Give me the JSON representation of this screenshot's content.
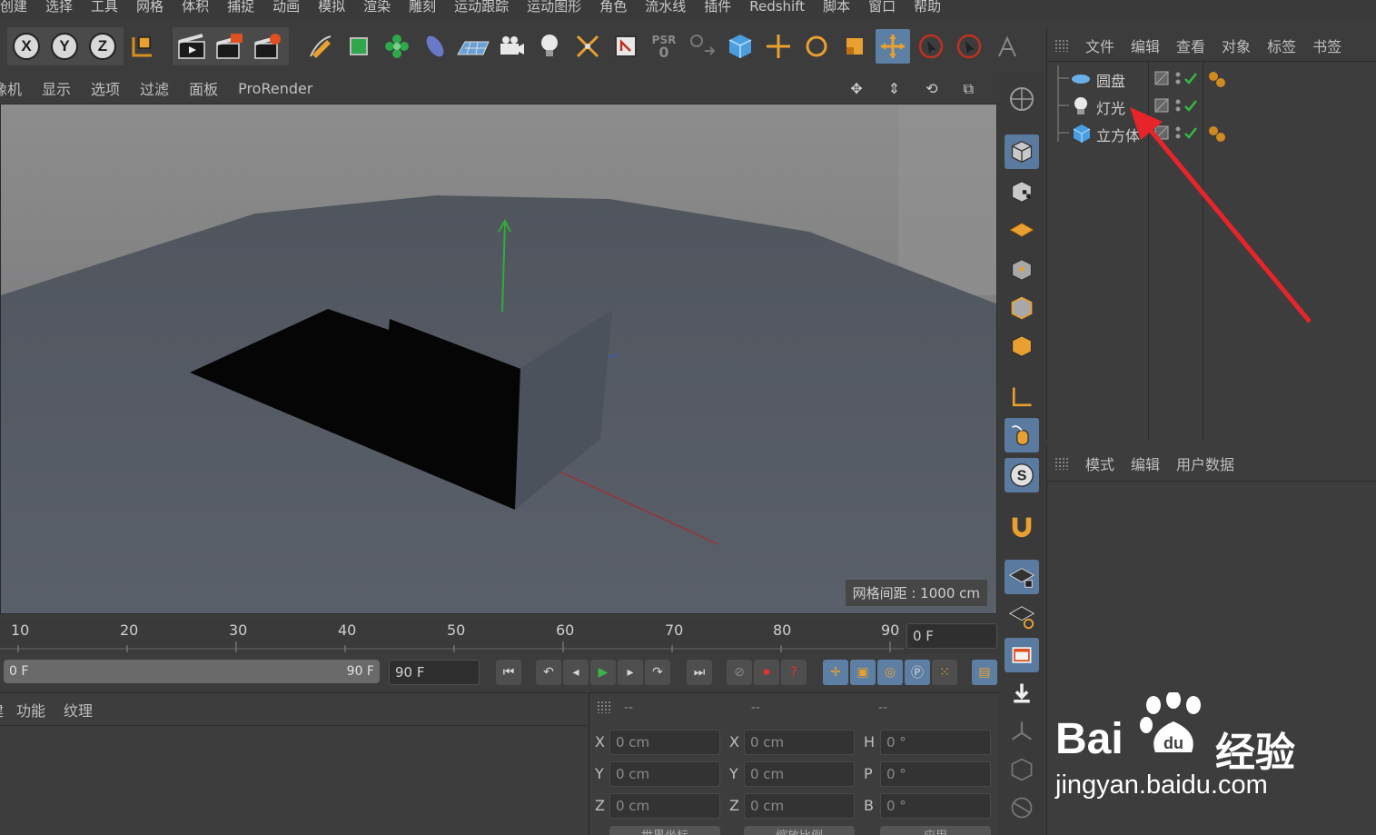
{
  "menubar": {
    "items": [
      "创建",
      "选择",
      "工具",
      "网格",
      "体积",
      "捕捉",
      "动画",
      "模拟",
      "渲染",
      "雕刻",
      "运动跟踪",
      "运动图形",
      "角色",
      "流水线",
      "插件",
      "Redshift",
      "脚本",
      "窗口",
      "帮助"
    ]
  },
  "toolbar": {
    "axis_x": "X",
    "axis_y": "Y",
    "axis_z": "Z",
    "psr_label": "PSR",
    "psr_value": "0"
  },
  "viewport_menu": {
    "items": [
      "摄像机",
      "显示",
      "选项",
      "过滤",
      "面板",
      "ProRender"
    ]
  },
  "viewport": {
    "grid_spacing": "网格间距 : 1000 cm"
  },
  "object_manager": {
    "menu": [
      "文件",
      "编辑",
      "查看",
      "对象",
      "标签",
      "书签"
    ],
    "objects": [
      {
        "name": "圆盘",
        "icon": "disc-icon"
      },
      {
        "name": "灯光",
        "icon": "light-bulb-icon"
      },
      {
        "name": "立方体",
        "icon": "cube-icon"
      }
    ]
  },
  "attribute_manager": {
    "menu": [
      "模式",
      "编辑",
      "用户数据"
    ]
  },
  "timeline": {
    "ticks": [
      "10",
      "20",
      "30",
      "40",
      "50",
      "60",
      "70",
      "80",
      "90"
    ],
    "current_frame": "0 F"
  },
  "playback": {
    "range_start": "0 F",
    "range_end": "90 F",
    "end_frame": "90 F"
  },
  "material_manager": {
    "menu": [
      "创建",
      "功能",
      "纹理"
    ]
  },
  "coordinates": {
    "headers": [
      "--",
      "--",
      "--"
    ],
    "rows": [
      {
        "pos_label": "X",
        "pos": "0 cm",
        "size_label": "X",
        "size": "0 cm",
        "rot_label": "H",
        "rot": "0 °"
      },
      {
        "pos_label": "Y",
        "pos": "0 cm",
        "size_label": "Y",
        "size": "0 cm",
        "rot_label": "P",
        "rot": "0 °"
      },
      {
        "pos_label": "Z",
        "pos": "0 cm",
        "size_label": "Z",
        "size": "0 cm",
        "rot_label": "B",
        "rot": "0 °"
      }
    ],
    "buttons": [
      "世界坐标",
      "缩放比例",
      "应用"
    ]
  },
  "watermark": {
    "brand_left": "Bai",
    "brand_right": "经验",
    "url": "jingyan.baidu.com"
  },
  "colors": {
    "accent_blue": "#5d7fa3",
    "arrow_red": "#e8242b",
    "check_green": "#3ab54a"
  }
}
